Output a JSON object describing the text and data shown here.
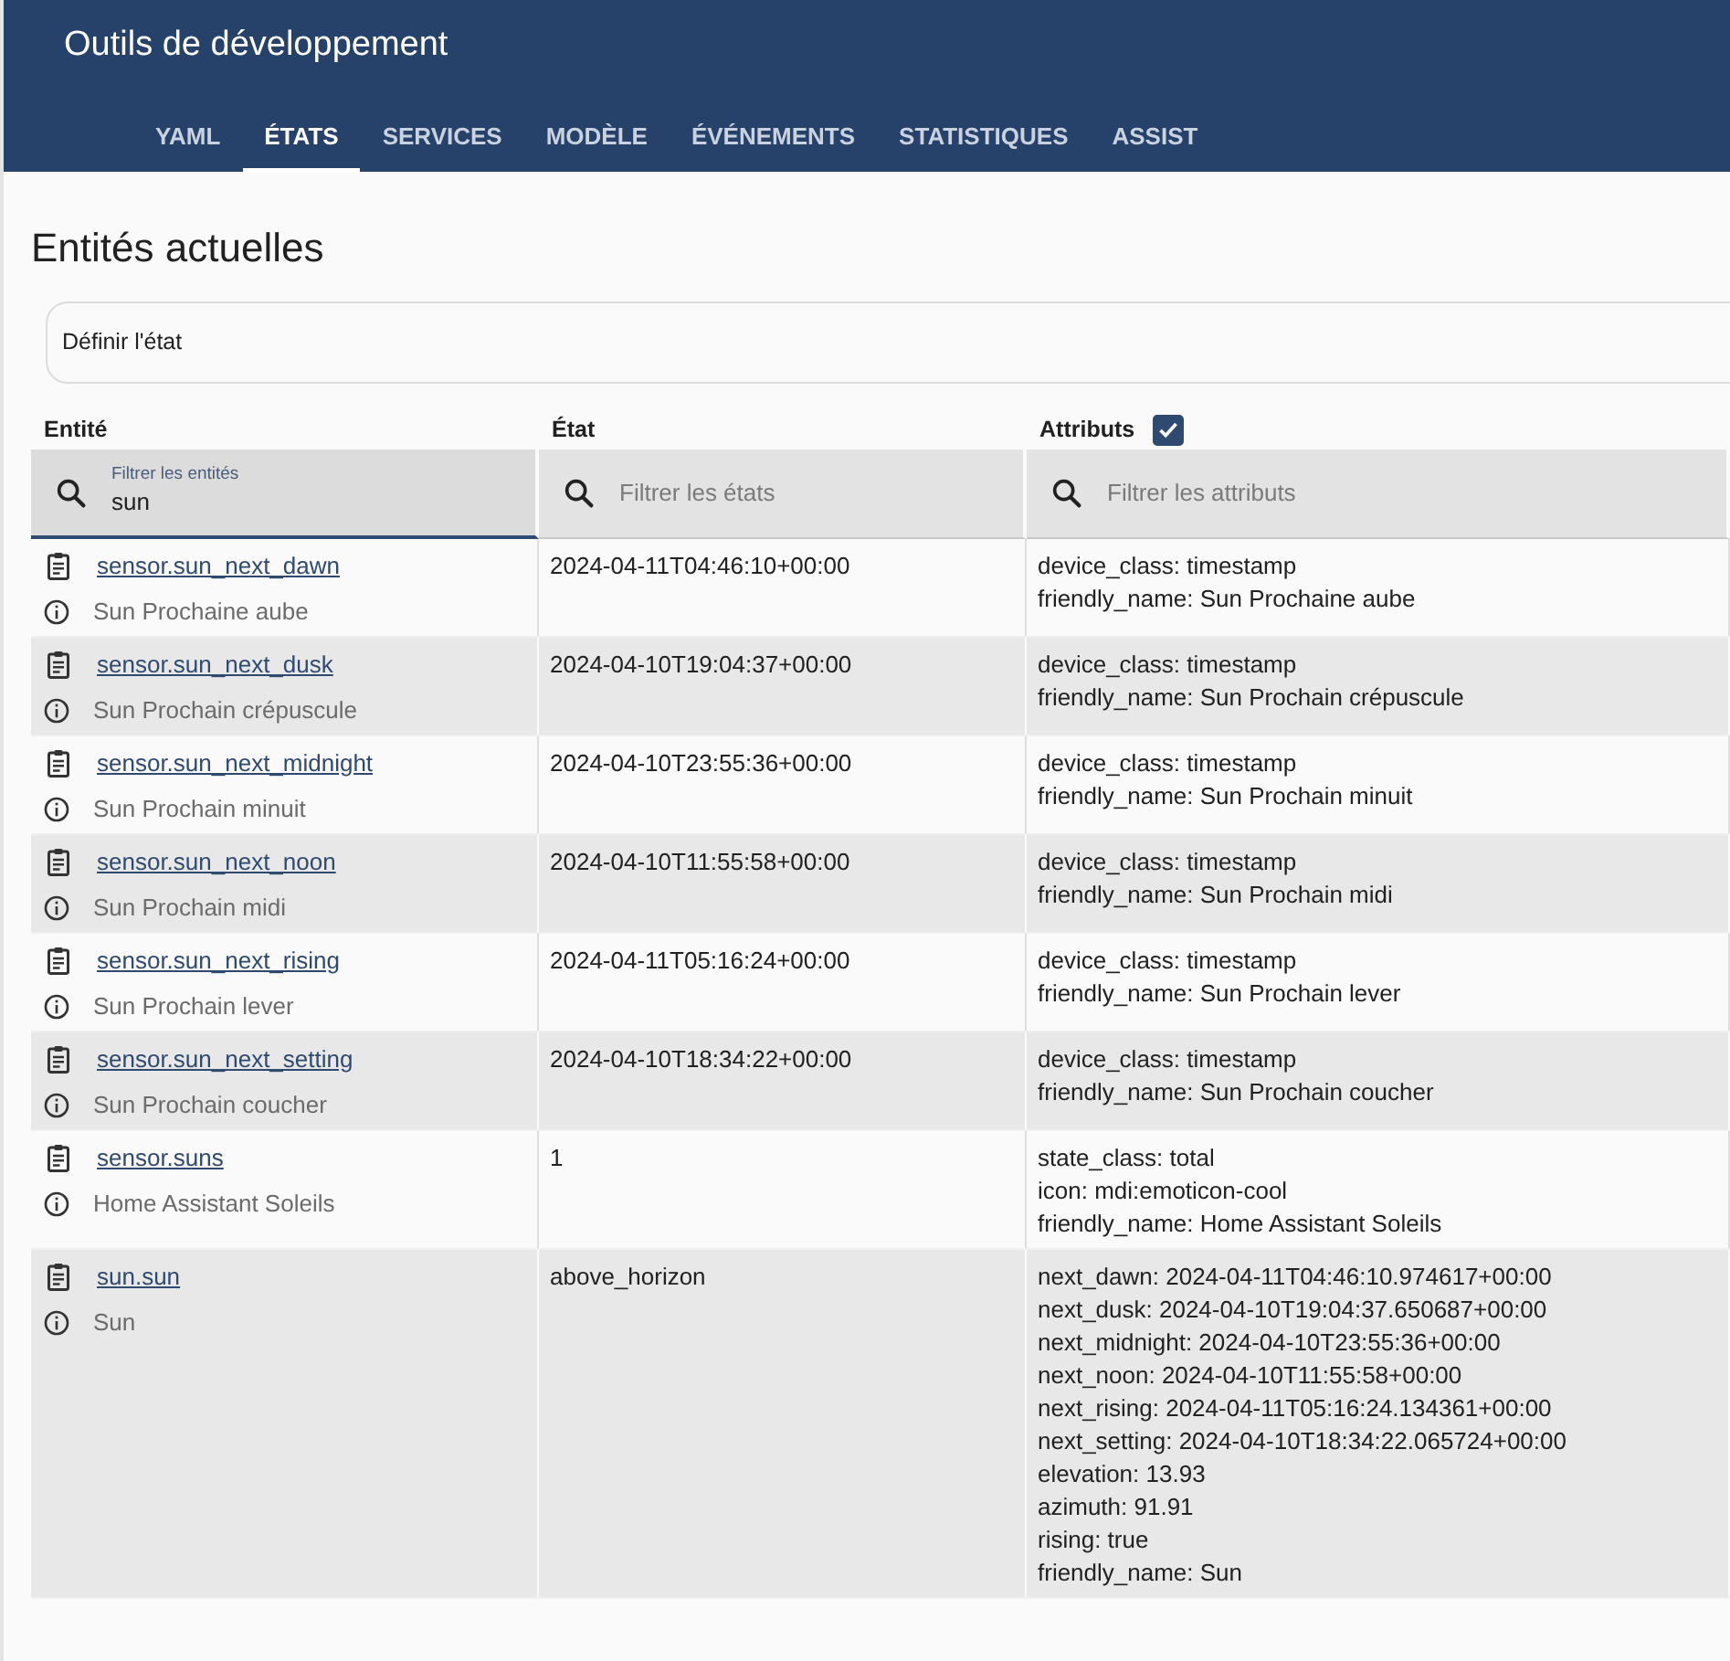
{
  "header": {
    "title": "Outils de développement",
    "tabs": [
      {
        "label": "YAML",
        "selected": false
      },
      {
        "label": "ÉTATS",
        "selected": true
      },
      {
        "label": "SERVICES",
        "selected": false
      },
      {
        "label": "MODÈLE",
        "selected": false
      },
      {
        "label": "ÉVÉNEMENTS",
        "selected": false
      },
      {
        "label": "STATISTIQUES",
        "selected": false
      },
      {
        "label": "ASSIST",
        "selected": false
      }
    ]
  },
  "heading": "Entités actuelles",
  "set_state": {
    "title": "Définir l'état"
  },
  "table": {
    "columns": [
      "Entité",
      "État",
      "Attributs"
    ],
    "attributes_checkbox": {
      "checked": true
    },
    "filters": [
      {
        "label": "Filtrer les entités",
        "value": "sun"
      },
      {
        "placeholder": "Filtrer les états"
      },
      {
        "placeholder": "Filtrer les attributs"
      }
    ],
    "rows": [
      {
        "entity_id": "sensor.sun_next_dawn",
        "name": "Sun Prochaine aube",
        "state": "2024-04-11T04:46:10+00:00",
        "attributes": [
          "device_class: timestamp",
          "friendly_name: Sun Prochaine aube"
        ]
      },
      {
        "entity_id": "sensor.sun_next_dusk",
        "name": "Sun Prochain crépuscule",
        "state": "2024-04-10T19:04:37+00:00",
        "attributes": [
          "device_class: timestamp",
          "friendly_name: Sun Prochain crépuscule"
        ]
      },
      {
        "entity_id": "sensor.sun_next_midnight",
        "name": "Sun Prochain minuit",
        "state": "2024-04-10T23:55:36+00:00",
        "attributes": [
          "device_class: timestamp",
          "friendly_name: Sun Prochain minuit"
        ]
      },
      {
        "entity_id": "sensor.sun_next_noon",
        "name": "Sun Prochain midi",
        "state": "2024-04-10T11:55:58+00:00",
        "attributes": [
          "device_class: timestamp",
          "friendly_name: Sun Prochain midi"
        ]
      },
      {
        "entity_id": "sensor.sun_next_rising",
        "name": "Sun Prochain lever",
        "state": "2024-04-11T05:16:24+00:00",
        "attributes": [
          "device_class: timestamp",
          "friendly_name: Sun Prochain lever"
        ]
      },
      {
        "entity_id": "sensor.sun_next_setting",
        "name": "Sun Prochain coucher",
        "state": "2024-04-10T18:34:22+00:00",
        "attributes": [
          "device_class: timestamp",
          "friendly_name: Sun Prochain coucher"
        ]
      },
      {
        "entity_id": "sensor.suns",
        "name": "Home Assistant Soleils",
        "state": "1",
        "attributes": [
          "state_class: total",
          "icon: mdi:emoticon-cool",
          "friendly_name: Home Assistant Soleils"
        ]
      },
      {
        "entity_id": "sun.sun",
        "name": "Sun",
        "state": "above_horizon",
        "attributes": [
          "next_dawn: 2024-04-11T04:46:10.974617+00:00",
          "next_dusk: 2024-04-10T19:04:37.650687+00:00",
          "next_midnight: 2024-04-10T23:55:36+00:00",
          "next_noon: 2024-04-10T11:55:58+00:00",
          "next_rising: 2024-04-11T05:16:24.134361+00:00",
          "next_setting: 2024-04-10T18:34:22.065724+00:00",
          "elevation: 13.93",
          "azimuth: 91.91",
          "rising: true",
          "friendly_name: Sun"
        ]
      }
    ]
  }
}
